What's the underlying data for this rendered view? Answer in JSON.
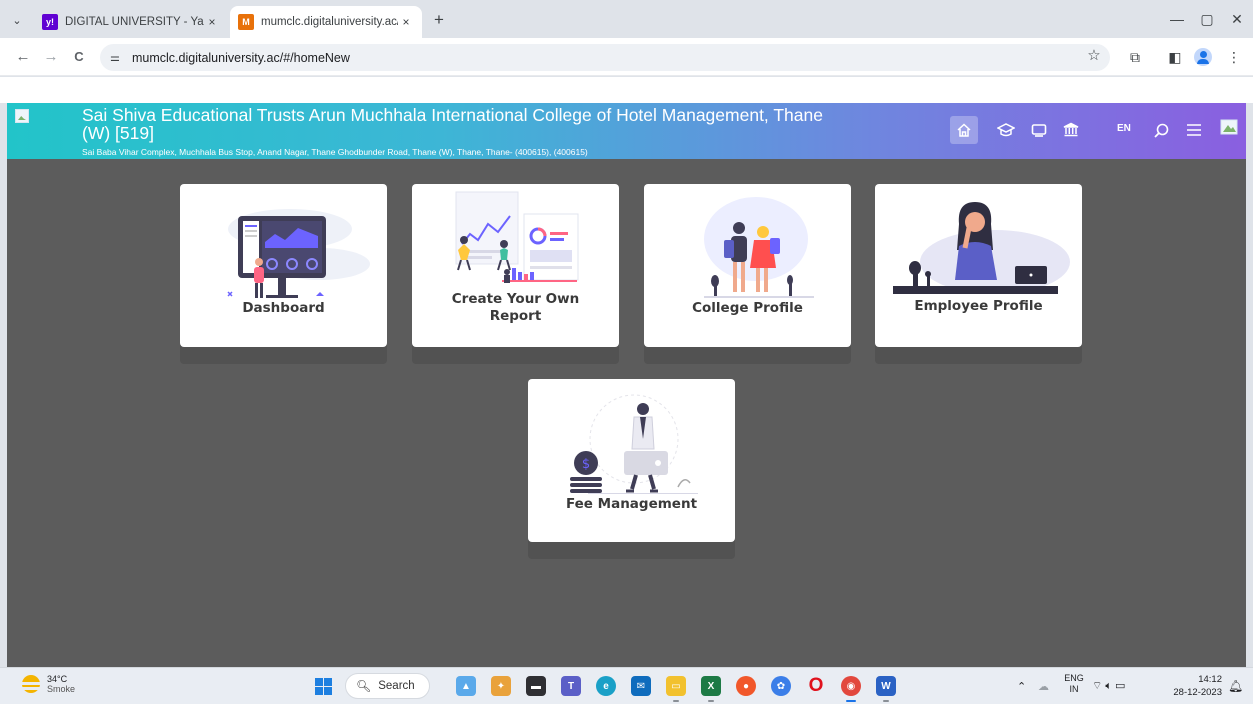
{
  "browser": {
    "tabs": [
      {
        "title": "DIGITAL UNIVERSITY - Yahoo In",
        "favicon": "yahoo-mail-icon",
        "active": false
      },
      {
        "title": "mumclc.digitaluniversity.ac/#/h",
        "favicon": "digital-university-icon",
        "active": true
      }
    ],
    "new_tab_label": "+",
    "close_glyph": "×",
    "window": {
      "minimize": "—",
      "restore": "▢",
      "close": "✕"
    },
    "address": "mumclc.digitaluniversity.ac/#/homeNew",
    "nav": {
      "back": "←",
      "forward": "→",
      "reload": "C"
    }
  },
  "header": {
    "college_name": "Sai Shiva Educational Trusts Arun Muchhala International College of Hotel Management, Thane (W) [519]",
    "address": "Sai Baba Vihar Complex, Muchhala Bus Stop, Anand Nagar, Thane Ghodbunder Road, Thane (W), Thane, Thane- (400615), (400615)",
    "language": "EN",
    "gradient": [
      "#22c4c9",
      "#8a5fe0"
    ],
    "icons": [
      "home-icon",
      "graduation-cap-icon",
      "monitor-icon",
      "institution-icon",
      "search-icon",
      "menu-icon",
      "user-avatar-icon"
    ]
  },
  "cards": [
    {
      "label": "Dashboard",
      "illustration": "dashboard-illustration"
    },
    {
      "label": "Create Your Own Report",
      "illustration": "report-illustration"
    },
    {
      "label": "College Profile",
      "illustration": "college-profile-illustration"
    },
    {
      "label": "Employee Profile",
      "illustration": "employee-profile-illustration"
    },
    {
      "label": "Fee Management",
      "illustration": "fee-management-illustration"
    }
  ],
  "taskbar": {
    "weather": {
      "temp": "34°C",
      "condition": "Smoke"
    },
    "search_placeholder": "Search",
    "apps": [
      "photos-app-icon",
      "game-app-icon",
      "file-app-icon",
      "teams-icon",
      "edge-icon",
      "mail-icon",
      "file-explorer-icon",
      "excel-icon",
      "firefox-icon",
      "copilot-icon",
      "opera-icon",
      "chrome-icon",
      "word-icon"
    ],
    "language": {
      "line1": "ENG",
      "line2": "IN"
    },
    "time": "14:12",
    "date": "28-12-2023"
  }
}
